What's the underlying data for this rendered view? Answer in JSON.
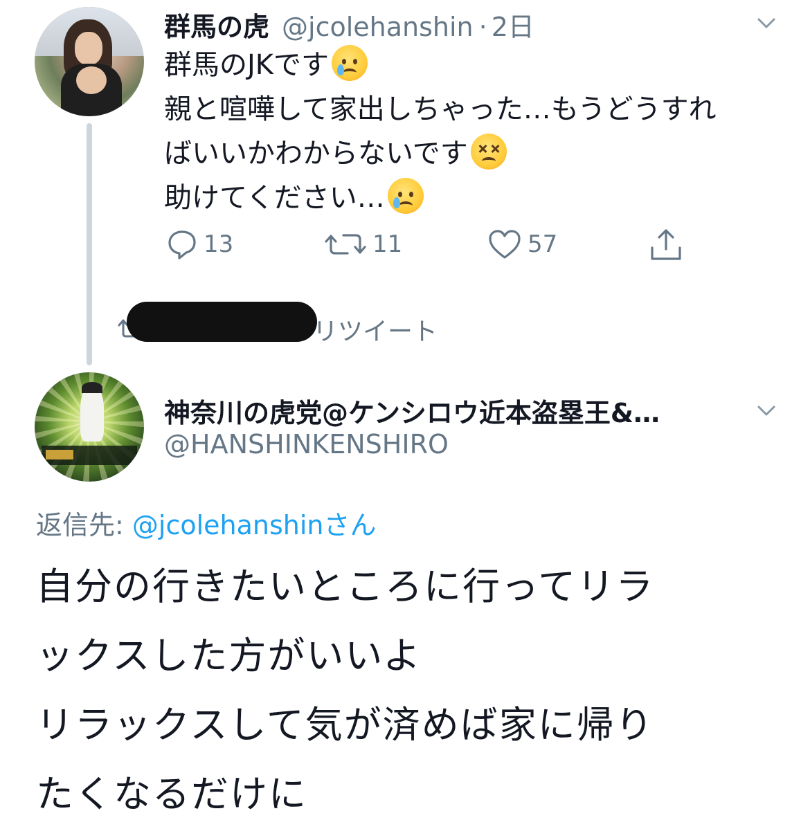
{
  "tweet1": {
    "avatar_icon": "profile-photo",
    "name": "群馬の虎",
    "handle": "@jcolehanshin",
    "separator": "·",
    "time": "2日",
    "lines": [
      {
        "text": "群馬のJKです",
        "emoji": "crying-face-emoji"
      },
      {
        "text": "親と喧嘩して家出しちゃった…もうどうすれ",
        "emoji": ""
      },
      {
        "text": "ばいいかわからないです",
        "emoji": "confounded-face-emoji"
      },
      {
        "text": "助けてください…",
        "emoji": "crying-face-emoji"
      }
    ],
    "actions": {
      "reply_count": "13",
      "retweet_count": "11",
      "like_count": "57"
    }
  },
  "retweet_notice": {
    "text": "リツイート"
  },
  "tweet2": {
    "avatar_icon": "baseball-card-avatar",
    "name": "神奈川の虎党@ケンシロウ近本盗塁王&…",
    "handle": "@HANSHINKENSHIRO",
    "reply_prefix": "返信先:",
    "reply_handle": "@jcolehanshin",
    "reply_suffix": "さん",
    "lines": [
      "自分の行きたいところに行ってリラ",
      "ックスした方がいいよ",
      "リラックスして気が済めば家に帰り",
      "たくなるだけに"
    ]
  },
  "colors": {
    "text": "#141823",
    "muted": "#657786",
    "link": "#1da1f2",
    "thread_line": "#cdd6dd"
  }
}
